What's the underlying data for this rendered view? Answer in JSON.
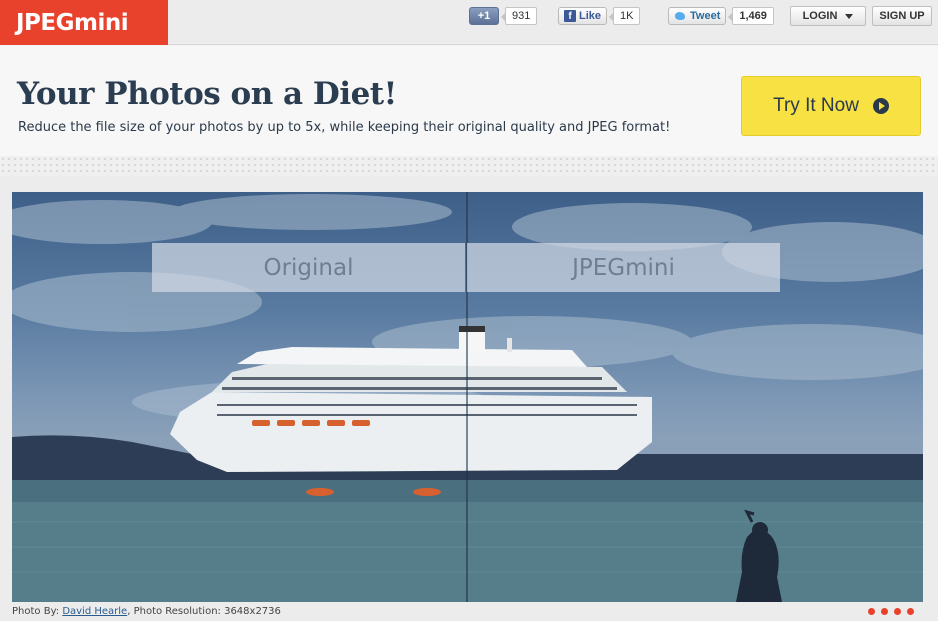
{
  "logo": {
    "text": "JPEGmini"
  },
  "social": {
    "gplus_label": "+1",
    "gplus_count": "931",
    "fb_label": "Like",
    "fb_count": "1K",
    "tw_label": "Tweet",
    "tw_count": "1,469"
  },
  "nav": {
    "login": "LOGIN",
    "signup": "SIGN UP"
  },
  "hero": {
    "headline": "Your Photos on a Diet!",
    "subline": "Reduce the file size of your photos by up to 5x, while keeping their original quality and JPEG format!",
    "cta": "Try It Now"
  },
  "viewer": {
    "left_label": "Original",
    "right_label": "JPEGmini",
    "credit_prefix": "Photo By: ",
    "credit_author": "David Hearle",
    "credit_suffix": ", Photo Resolution: 3648x2736",
    "slides": 4,
    "accent": "#e8412c"
  },
  "colors": {
    "brand_red": "#e8412c",
    "cta_yellow": "#f8e142",
    "heading_navy": "#2b3d50"
  }
}
